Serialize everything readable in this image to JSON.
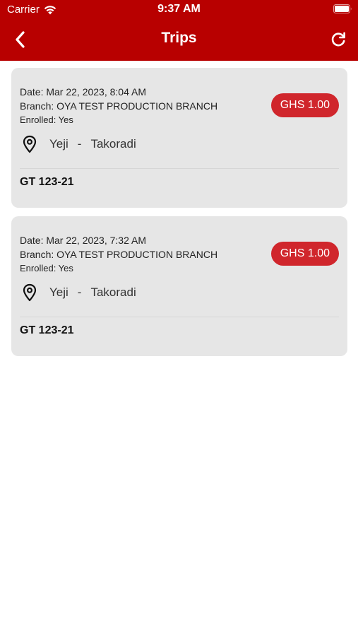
{
  "status_bar": {
    "carrier": "Carrier",
    "time": "9:37 AM"
  },
  "navbar": {
    "title": "Trips",
    "back_icon": "chevron-left-icon",
    "refresh_icon": "refresh-icon"
  },
  "colors": {
    "header": "#b80000",
    "badge": "#d0262c",
    "card": "#e6e6e6"
  },
  "trips": [
    {
      "date": "Date: Mar 22, 2023, 8:04 AM",
      "branch": "Branch: OYA TEST PRODUCTION BRANCH",
      "enrolled": "Enrolled: Yes",
      "price": "GHS 1.00",
      "from": "Yeji",
      "separator": "-",
      "to": "Takoradi",
      "vehicle": "GT 123-21"
    },
    {
      "date": "Date: Mar 22, 2023, 7:32 AM",
      "branch": "Branch: OYA TEST PRODUCTION BRANCH",
      "enrolled": "Enrolled: Yes",
      "price": "GHS 1.00",
      "from": "Yeji",
      "separator": "-",
      "to": "Takoradi",
      "vehicle": "GT 123-21"
    }
  ]
}
